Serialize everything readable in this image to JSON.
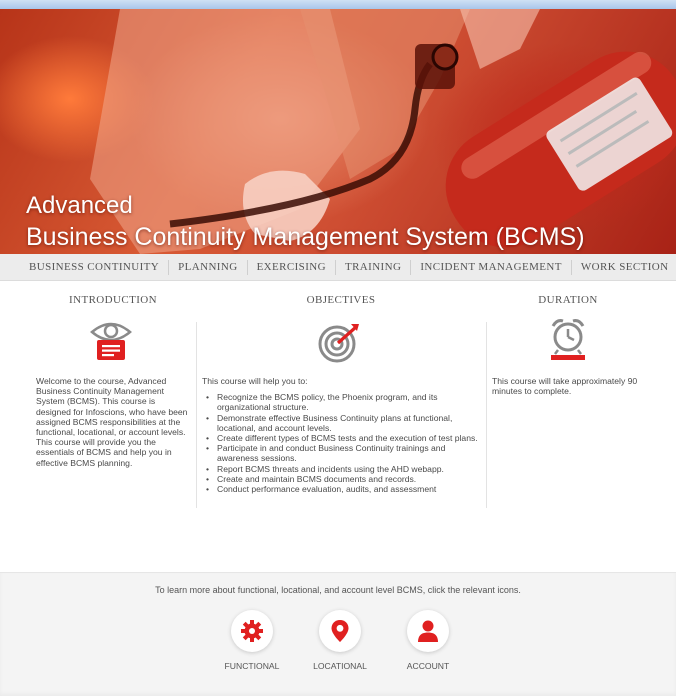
{
  "hero": {
    "title_line1": "Advanced",
    "title_line2": "Business Continuity Management System (BCMS)"
  },
  "nav": {
    "items": [
      "BUSINESS CONTINUITY",
      "PLANNING",
      "EXERCISING",
      "TRAINING",
      "INCIDENT MANAGEMENT",
      "WORK SECTION"
    ]
  },
  "introduction": {
    "title": "INTRODUCTION",
    "icon": "eye-document-icon",
    "text": "Welcome to the course, Advanced Business Continuity Management System (BCMS). This course is designed for Infoscions, who have been assigned BCMS responsibilities at the functional, locational, or account levels. This course will provide you the essentials of BCMS and help you in effective BCMS planning."
  },
  "objectives": {
    "title": "OBJECTIVES",
    "icon": "target-icon",
    "intro": "This course will help you to:",
    "items": [
      "Recognize the BCMS policy, the Phoenix program, and its organizational structure.",
      "Demonstrate effective Business Continuity plans at functional, locational, and account levels.",
      "Create different types of BCMS tests and the execution of test plans.",
      "Participate in and conduct Business Continuity trainings and awareness sessions.",
      "Report BCMS threats and incidents using the AHD webapp.",
      "Create and maintain BCMS documents and records.",
      "Conduct performance evaluation, audits, and assessment"
    ]
  },
  "duration": {
    "title": "DURATION",
    "icon": "alarm-clock-icon",
    "text": "This course will take approximately 90 minutes to complete."
  },
  "bottom": {
    "prompt": "To learn more about functional, locational, and account level BCMS, click the relevant icons.",
    "buttons": [
      {
        "label": "FUNCTIONAL",
        "icon": "gear-icon"
      },
      {
        "label": "LOCATIONAL",
        "icon": "map-pin-icon"
      },
      {
        "label": "ACCOUNT",
        "icon": "person-icon"
      }
    ]
  },
  "colors": {
    "accent": "#e02020",
    "icon_gray": "#8a8a8a",
    "nav_bg": "#ececec"
  }
}
